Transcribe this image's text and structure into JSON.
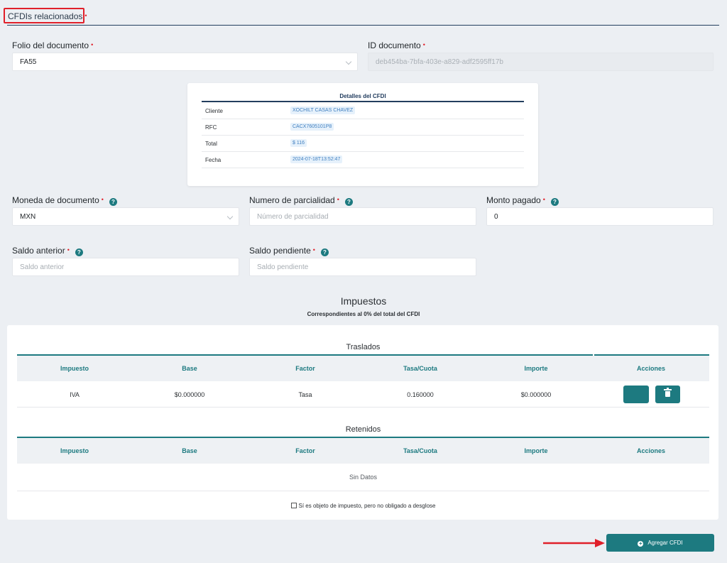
{
  "section": {
    "title": "CFDIs relacionados",
    "required_mark": "•"
  },
  "folio": {
    "label": "Folio del documento",
    "required_mark": "•",
    "value": "FA55"
  },
  "id_documento": {
    "label": "ID documento",
    "required_mark": "•",
    "value": "deb454ba-7bfa-403e-a829-adf2595ff17b"
  },
  "detalles": {
    "title": "Detalles del CFDI",
    "rows": [
      {
        "key": "Cliente",
        "value": "XOCHILT CASAS CHAVEZ"
      },
      {
        "key": "RFC",
        "value": "CACX7605101P8"
      },
      {
        "key": "Total",
        "value": "$ 116"
      },
      {
        "key": "Fecha",
        "value": "2024-07-18T13:52:47"
      }
    ]
  },
  "moneda": {
    "label": "Moneda de documento",
    "required_mark": "•",
    "value": "MXN",
    "help": "?"
  },
  "parcialidad": {
    "label": "Numero de parcialidad",
    "required_mark": "•",
    "placeholder": "Número de parcialidad",
    "help": "?"
  },
  "monto": {
    "label": "Monto pagado",
    "required_mark": "•",
    "value": "0",
    "help": "?"
  },
  "saldo_anterior": {
    "label": "Saldo anterior",
    "required_mark": "•",
    "placeholder": "Saldo anterior",
    "help": "?"
  },
  "saldo_pendiente": {
    "label": "Saldo pendiente",
    "required_mark": "•",
    "placeholder": "Saldo pendiente",
    "help": "?"
  },
  "impuestos": {
    "title": "Impuestos",
    "subtitle": "Correspondientes al 0% del total del CFDI",
    "columns": [
      "Impuesto",
      "Base",
      "Factor",
      "Tasa/Cuota",
      "Importe",
      "Acciones"
    ],
    "traslados": {
      "title": "Traslados",
      "rows": [
        {
          "impuesto": "IVA",
          "base": "$0.000000",
          "factor": "Tasa",
          "tasa": "0.160000",
          "importe": "$0.000000"
        }
      ]
    },
    "retenidos": {
      "title": "Retenidos",
      "empty": "Sin Datos"
    },
    "checkbox_label": "Sí es objeto de impuesto, pero no obligado a desglose"
  },
  "add_button": {
    "label": "Agregar CFDI",
    "icon": "plus-circle-icon"
  },
  "colors": {
    "accent": "#1d7a80",
    "navy": "#233e5e",
    "required": "#e0202a",
    "annotation": "#e0202a"
  }
}
